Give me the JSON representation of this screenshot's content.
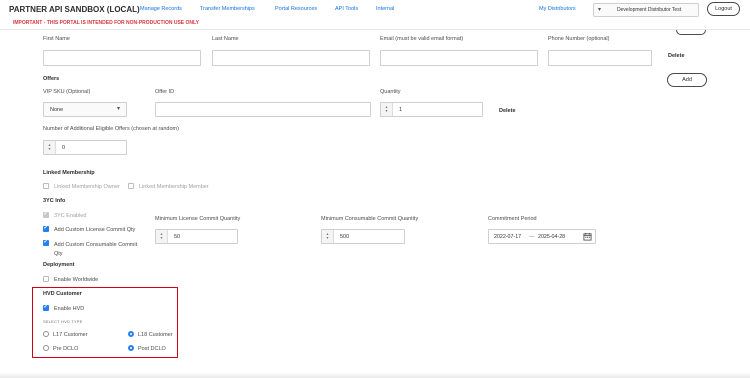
{
  "header": {
    "brand": "PARTNER API SANDBOX (LOCAL)",
    "warning": "IMPORTANT - THIS PORTAL IS INTENDED FOR NON-PRODUCTION USE ONLY",
    "nav": [
      "Manage Records",
      "Transfer Memberships",
      "Portal Resources",
      "API Tools",
      "Internal"
    ],
    "my_distributors": "My Distributors",
    "distributor_value": "Development Distributor Test",
    "logout": "Logout"
  },
  "contact": {
    "first_name": "First Name",
    "last_name": "Last Name",
    "email": "Email (must be valid email format)",
    "phone": "Phone Number (optional)",
    "delete": "Delete"
  },
  "offers": {
    "title": "Offers",
    "add": "Add",
    "vip_sku_label": "VIP SKU (Optional)",
    "vip_sku_value": "None",
    "offer_id_label": "Offer ID",
    "quantity_label": "Quantity",
    "quantity_value": "1",
    "delete": "Delete",
    "additional_label": "Number of Additional Eligible Offers (chosen at random)",
    "additional_value": "0"
  },
  "linked_membership": {
    "title": "Linked Membership",
    "owner": "Linked Membership Owner",
    "member": "Linked Membership Member"
  },
  "three_yc": {
    "title": "3YC Info",
    "enabled": "3YC Enabled",
    "license_qty": "Add Custom License Commit Qty",
    "consumable_qty": "Add Custom Consumable Commit Qty",
    "min_license_label": "Minimum License Commit Quantity",
    "min_license_value": "50",
    "min_consumable_label": "Minimum Consumable Commit Quantity",
    "min_consumable_value": "500",
    "period_label": "Commitment Period",
    "period_start": "2022-07-17",
    "period_end": "2025-04-28",
    "period_sep": "—"
  },
  "deployment": {
    "title": "Deployment",
    "enable_worldwide": "Enable Worldwide"
  },
  "hvd": {
    "title": "HVD Customer",
    "enable": "Enable HVD",
    "select_type": "SELECT HVD TYPE",
    "l17": "L17 Customer",
    "l18": "L18 Customer",
    "pre_dclo": "Pre DCLO",
    "post_dclo": "Post DCLO"
  },
  "icons": {
    "stepper": "stepper-arrows-icon",
    "calendar": "calendar-icon",
    "chevron": "chevron-down-icon",
    "check": "checkmark-icon"
  },
  "colors": {
    "accent": "#1473e6",
    "warning": "#d7373f",
    "highlight_border": "#d0021b",
    "checkbox": "#2680eb"
  }
}
